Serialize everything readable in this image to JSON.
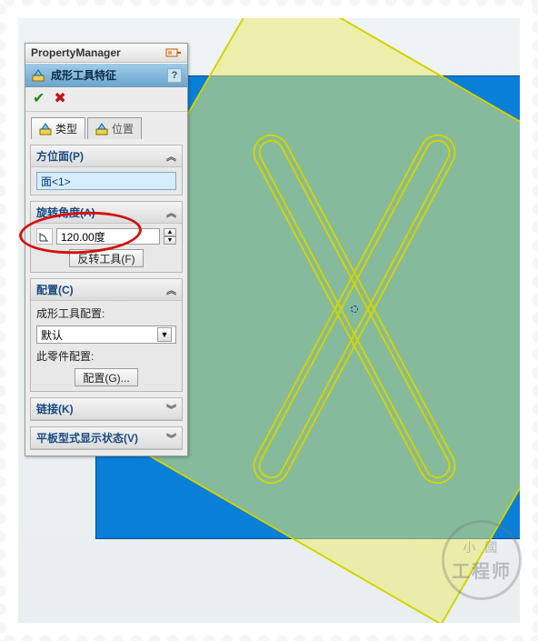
{
  "titlebar": {
    "title": "PropertyManager"
  },
  "feature": {
    "title": "成形工具特征",
    "help": "?"
  },
  "confirm": {
    "ok_glyph": "✔",
    "cancel_glyph": "✖"
  },
  "tabs": {
    "type": {
      "label": "类型"
    },
    "position": {
      "label": "位置"
    }
  },
  "sections": {
    "placement": {
      "title": "方位面(P)",
      "face_value": "面<1>"
    },
    "rotation": {
      "title": "旋转角度(A)",
      "angle_icon_label": "A1",
      "angle_value": "120.00度",
      "flip_btn": "反转工具(F)"
    },
    "config": {
      "title": "配置(C)",
      "tool_label": "成形工具配置:",
      "tool_selected": "默认",
      "part_label": "此零件配置:",
      "config_btn": "配置(G)..."
    },
    "link": {
      "title": "链接(K)"
    },
    "flat": {
      "title": "平板型式显示状态(V)"
    }
  },
  "watermark": {
    "line1": "小 國",
    "line2": "工程师"
  }
}
